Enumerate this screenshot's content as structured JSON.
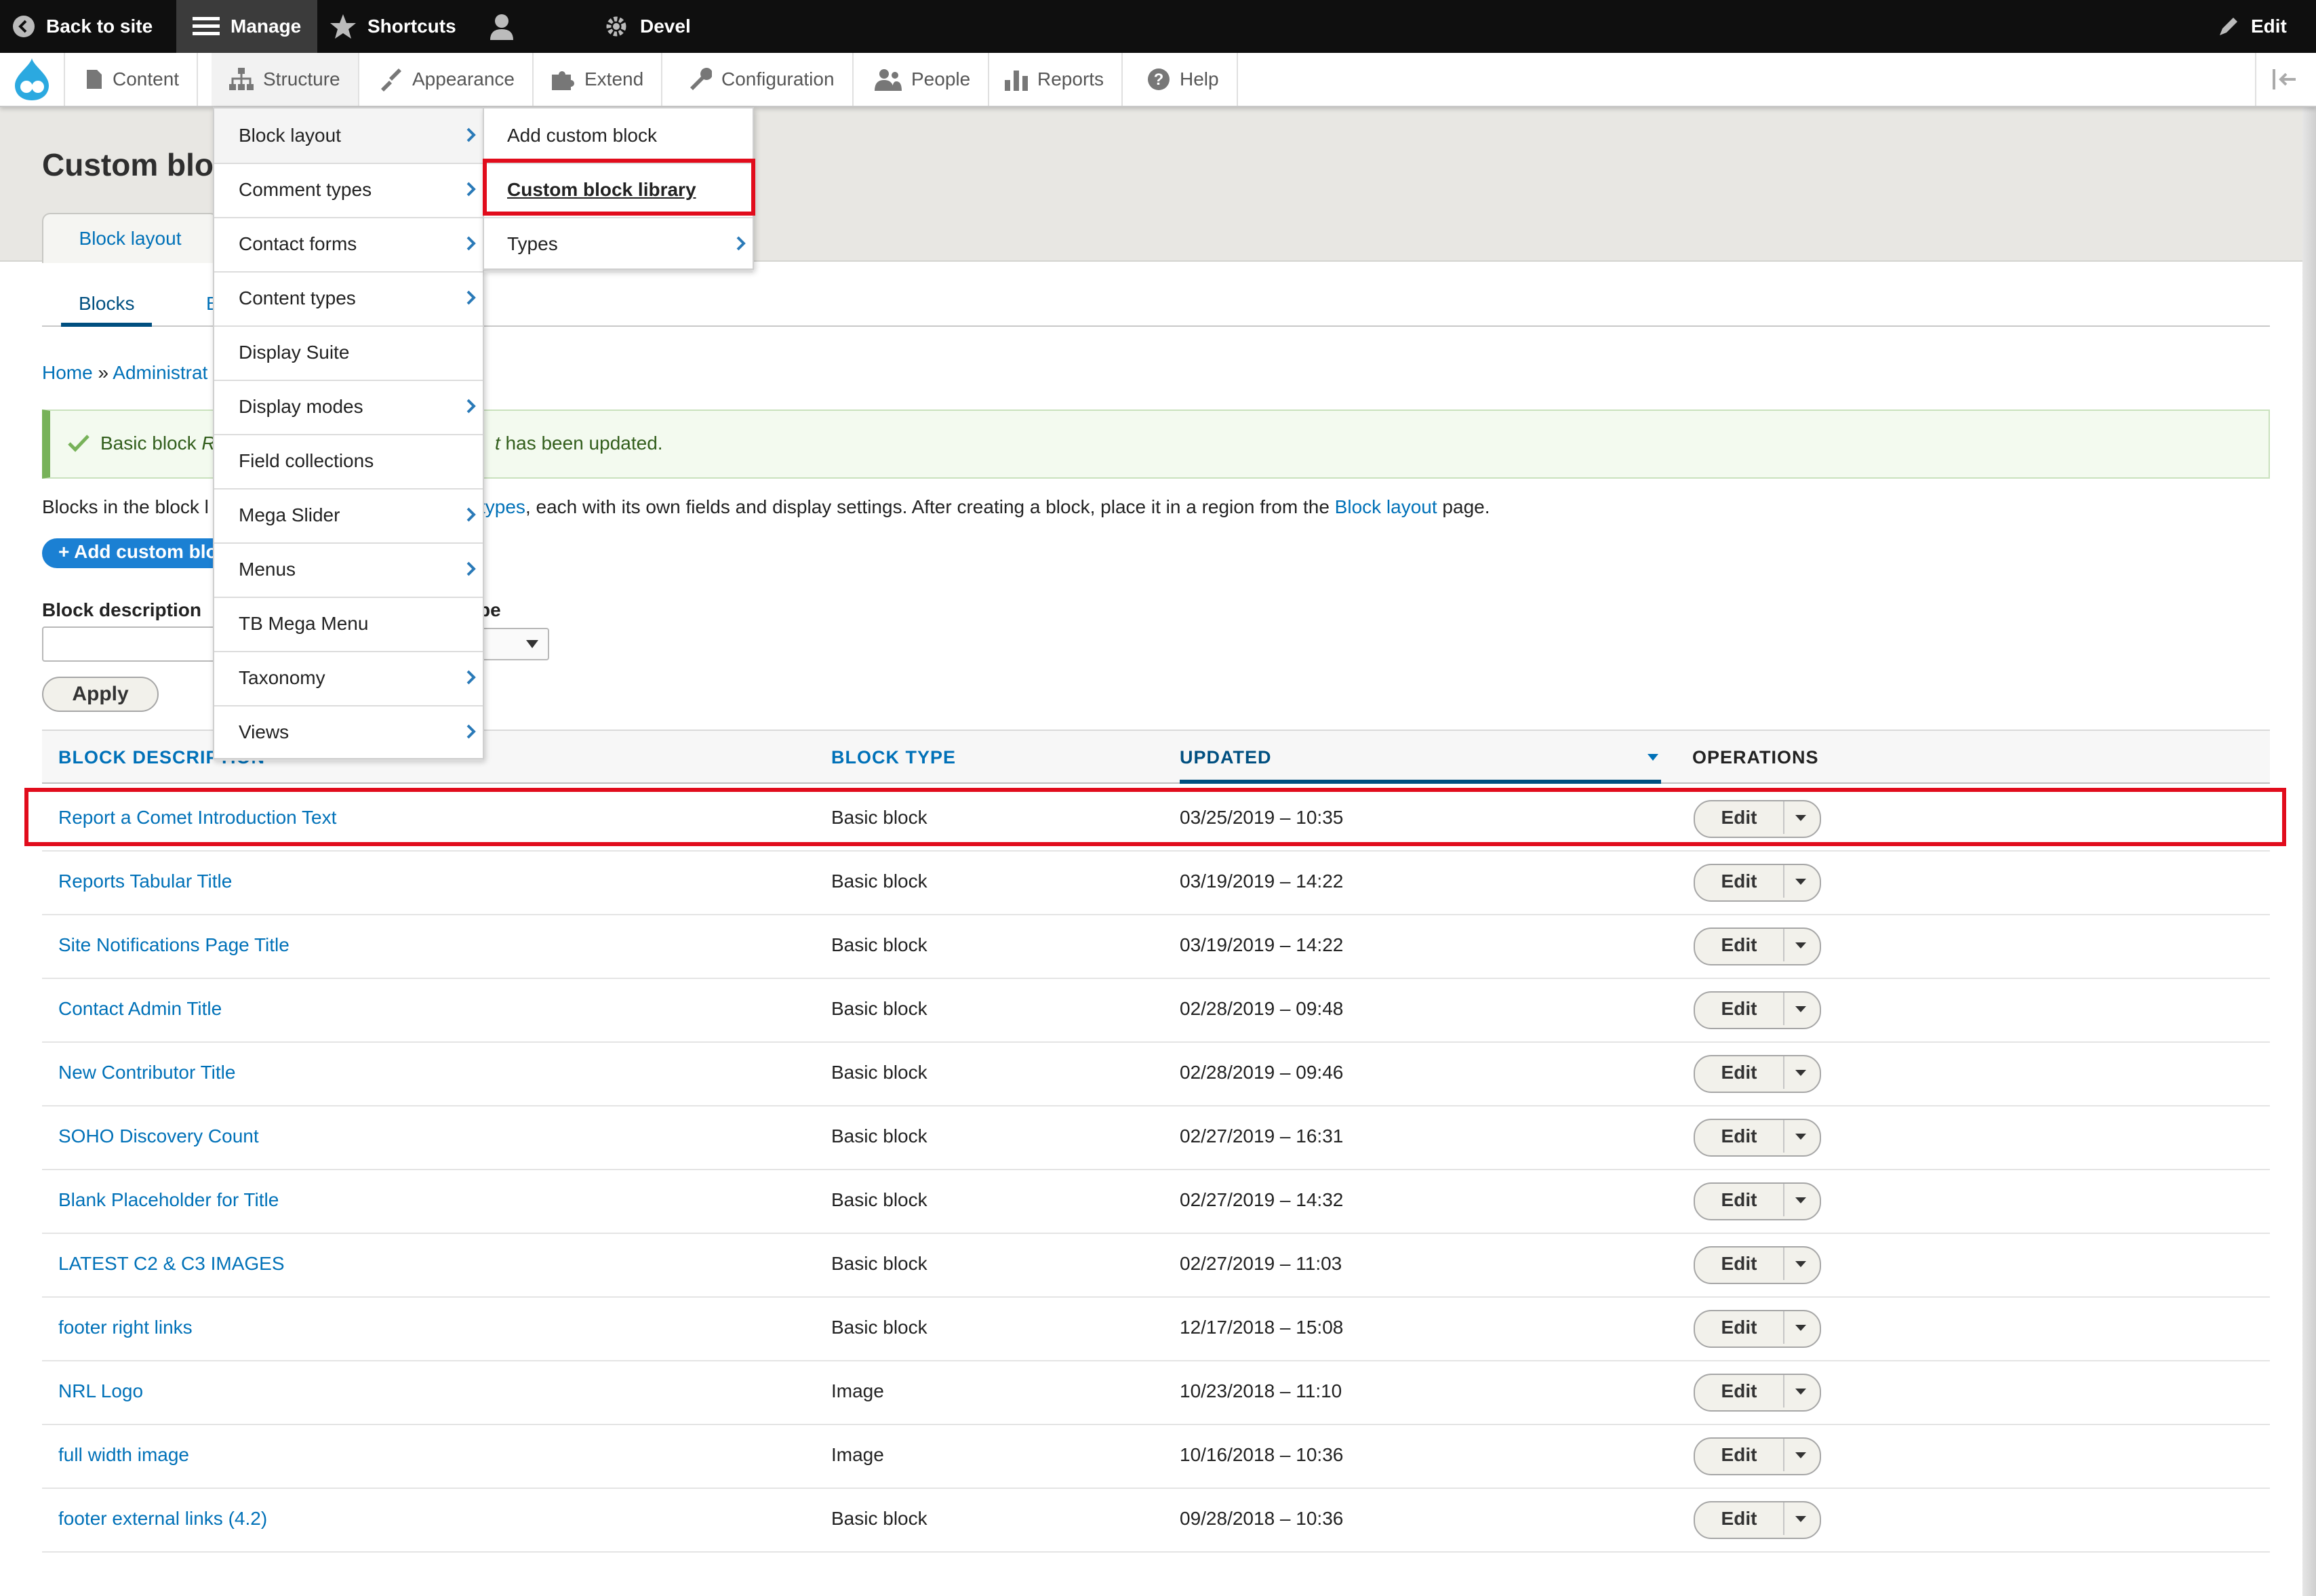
{
  "toolbar": {
    "back_to_site": "Back to site",
    "manage": "Manage",
    "shortcuts": "Shortcuts",
    "devel": "Devel",
    "edit": "Edit"
  },
  "tray": {
    "items": [
      "Content",
      "Structure",
      "Appearance",
      "Extend",
      "Configuration",
      "People",
      "Reports",
      "Help"
    ]
  },
  "page": {
    "title_visible": "Custom bloc",
    "primary_tab": "Block layout",
    "secondary_tab_active": "Blocks",
    "secondary_tab_partial": "B",
    "breadcrumb_home": "Home",
    "breadcrumb_sep": " » ",
    "breadcrumb_admin": "Administrat",
    "status_prefix": "Basic block ",
    "status_italic": "R",
    "status_suffix_italic": "t",
    "status_suffix": " has been updated.",
    "desc_prefix": "Blocks in the block l",
    "desc_link_1": "types",
    "desc_middle": ", each with its own fields and display settings. After creating a block, place it in a region from the ",
    "desc_link_2": "Block layout",
    "desc_end": " page.",
    "add_button": "+ Add custom blo",
    "filter_label": "Block description",
    "filter_label_2": "pe",
    "apply": "Apply"
  },
  "menu": {
    "structure_items": [
      {
        "label": "Block layout",
        "has_sub": true
      },
      {
        "label": "Comment types",
        "has_sub": true
      },
      {
        "label": "Contact forms",
        "has_sub": true
      },
      {
        "label": "Content types",
        "has_sub": true
      },
      {
        "label": "Display Suite",
        "has_sub": false
      },
      {
        "label": "Display modes",
        "has_sub": true
      },
      {
        "label": "Field collections",
        "has_sub": false
      },
      {
        "label": "Mega Slider",
        "has_sub": true
      },
      {
        "label": "Menus",
        "has_sub": true
      },
      {
        "label": "TB Mega Menu",
        "has_sub": false
      },
      {
        "label": "Taxonomy",
        "has_sub": true
      },
      {
        "label": "Views",
        "has_sub": true
      }
    ],
    "sub_items": [
      {
        "label": "Add custom block",
        "has_sub": false
      },
      {
        "label": "Custom block library",
        "has_sub": false
      },
      {
        "label": "Types",
        "has_sub": true
      }
    ]
  },
  "table": {
    "headers": {
      "description": "BLOCK DESCRIPTION",
      "type": "BLOCK TYPE",
      "updated": "UPDATED",
      "operations": "OPERATIONS"
    },
    "edit_label": "Edit",
    "rows": [
      {
        "description": "Report a Comet Introduction Text",
        "type": "Basic block",
        "updated": "03/25/2019 – 10:35"
      },
      {
        "description": "Reports Tabular Title",
        "type": "Basic block",
        "updated": "03/19/2019 – 14:22"
      },
      {
        "description": "Site Notifications Page Title",
        "type": "Basic block",
        "updated": "03/19/2019 – 14:22"
      },
      {
        "description": "Contact Admin Title",
        "type": "Basic block",
        "updated": "02/28/2019 – 09:48"
      },
      {
        "description": "New Contributor Title",
        "type": "Basic block",
        "updated": "02/28/2019 – 09:46"
      },
      {
        "description": "SOHO Discovery Count",
        "type": "Basic block",
        "updated": "02/27/2019 – 16:31"
      },
      {
        "description": "Blank Placeholder for Title",
        "type": "Basic block",
        "updated": "02/27/2019 – 14:32"
      },
      {
        "description": "LATEST C2 & C3 IMAGES",
        "type": "Basic block",
        "updated": "02/27/2019 – 11:03"
      },
      {
        "description": "footer right links",
        "type": "Basic block",
        "updated": "12/17/2018 – 15:08"
      },
      {
        "description": "NRL Logo",
        "type": "Image",
        "updated": "10/23/2018 – 11:10"
      },
      {
        "description": "full width image",
        "type": "Image",
        "updated": "10/16/2018 – 10:36"
      },
      {
        "description": "footer external links (4.2)",
        "type": "Basic block",
        "updated": "09/28/2018 – 10:36"
      }
    ]
  },
  "colors": {
    "link": "#0071b8",
    "highlight": "#e10c1c",
    "toolbar_bg": "#0f0f0f",
    "status_green": "#77b259"
  }
}
